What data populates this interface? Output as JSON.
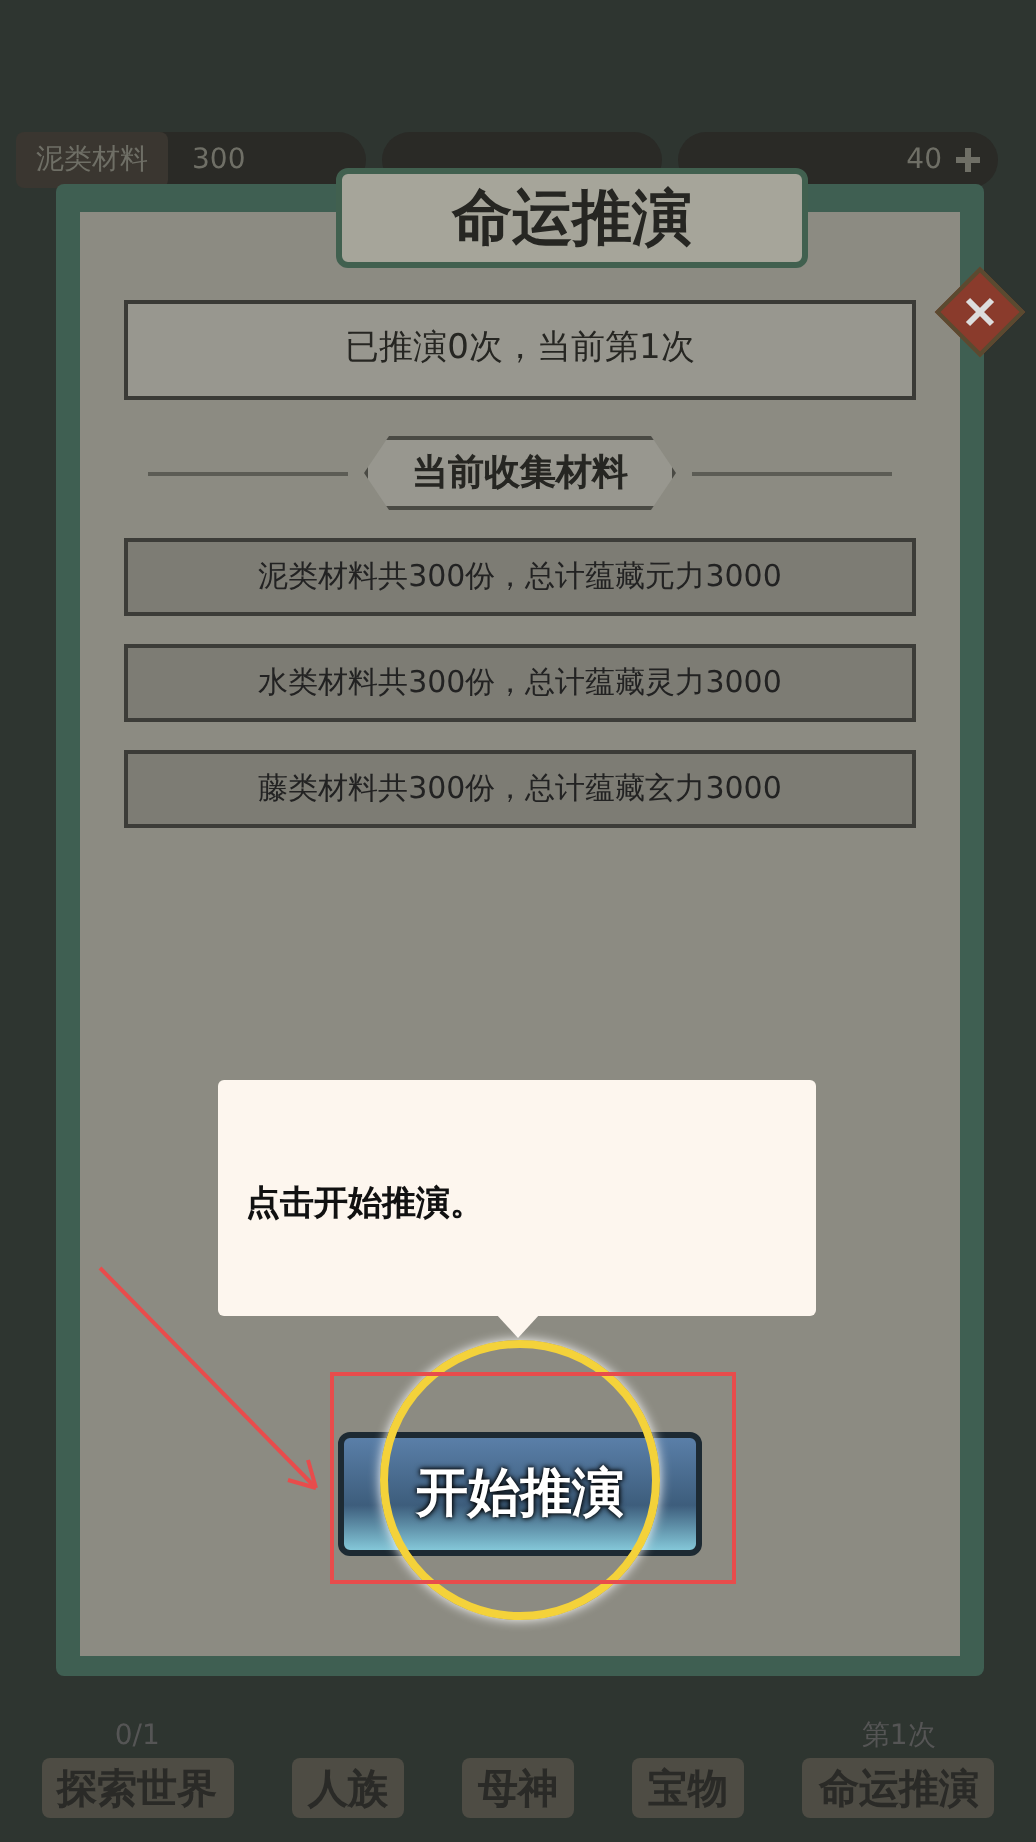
{
  "top_bar": {
    "material_label": "泥类材料",
    "material_count": "300",
    "gem_count": "40"
  },
  "dialog": {
    "title": "命运推演",
    "status": "已推演0次，当前第1次",
    "section_title": "当前收集材料",
    "materials": [
      "泥类材料共300份，总计蕴藏元力3000",
      "水类材料共300份，总计蕴藏灵力3000",
      "藤类材料共300份，总计蕴藏玄力3000"
    ],
    "start_button": "开始推演"
  },
  "guide": {
    "tip": "点击开始推演。"
  },
  "bottom_nav": [
    {
      "label": "探索世界",
      "count": "0/1"
    },
    {
      "label": "人族"
    },
    {
      "label": "母神"
    },
    {
      "label": "宝物"
    },
    {
      "label": "命运推演",
      "count": "第1次"
    }
  ]
}
